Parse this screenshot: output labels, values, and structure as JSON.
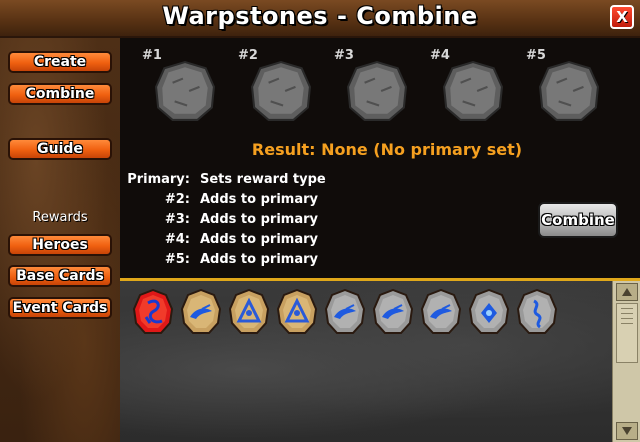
{
  "window": {
    "title": "Warpstones - Combine",
    "close_label": "X"
  },
  "sidebar": {
    "create": "Create",
    "combine": "Combine",
    "guide": "Guide",
    "rewards_heading": "Rewards",
    "heroes": "Heroes",
    "base_cards": "Base Cards",
    "event_cards": "Event Cards"
  },
  "slots": [
    {
      "label": "#1"
    },
    {
      "label": "#2"
    },
    {
      "label": "#3"
    },
    {
      "label": "#4"
    },
    {
      "label": "#5"
    }
  ],
  "result_text": "Result: None (No primary set)",
  "info": [
    {
      "key": "Primary:",
      "value": "Sets reward type"
    },
    {
      "key": "#2:",
      "value": "Adds to primary"
    },
    {
      "key": "#3:",
      "value": "Adds to primary"
    },
    {
      "key": "#4:",
      "value": "Adds to primary"
    },
    {
      "key": "#5:",
      "value": "Adds to primary"
    }
  ],
  "combine_button": "Combine",
  "inventory": [
    {
      "tier": "red",
      "rune": "hero-glyph"
    },
    {
      "tier": "gold",
      "rune": "blue-swirl"
    },
    {
      "tier": "gold",
      "rune": "blue-triangle"
    },
    {
      "tier": "gold",
      "rune": "blue-triangle"
    },
    {
      "tier": "gray",
      "rune": "blue-swirl"
    },
    {
      "tier": "gray",
      "rune": "blue-swirl"
    },
    {
      "tier": "gray",
      "rune": "blue-swirl"
    },
    {
      "tier": "gray",
      "rune": "blue-diamond"
    },
    {
      "tier": "gray",
      "rune": "blue-glyph"
    }
  ],
  "colors": {
    "accent": "#f06010",
    "result": "#f5a020",
    "divider": "#e0a81a"
  }
}
